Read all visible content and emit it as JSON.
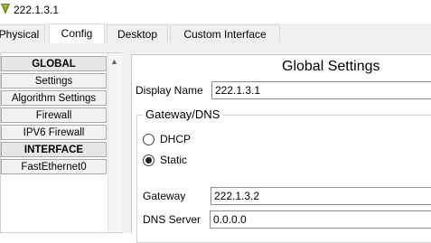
{
  "window": {
    "title": "222.1.3.1",
    "icon": "packet-tracer-app-icon"
  },
  "tabs": [
    {
      "label": "Physical",
      "active": false
    },
    {
      "label": "Config",
      "active": true
    },
    {
      "label": "Desktop",
      "active": false
    },
    {
      "label": "Custom Interface",
      "active": false
    }
  ],
  "sidebar": {
    "items": [
      {
        "label": "GLOBAL",
        "header": true
      },
      {
        "label": "Settings",
        "header": false
      },
      {
        "label": "Algorithm Settings",
        "header": false
      },
      {
        "label": "Firewall",
        "header": false
      },
      {
        "label": "IPV6 Firewall",
        "header": false
      },
      {
        "label": "INTERFACE",
        "header": true
      },
      {
        "label": "FastEthernet0",
        "header": false
      }
    ]
  },
  "main": {
    "title": "Global Settings",
    "display_name": {
      "label": "Display Name",
      "value": "222.1.3.1"
    },
    "gateway_dns": {
      "title": "Gateway/DNS",
      "dhcp_label": "DHCP",
      "static_label": "Static",
      "selected": "Static",
      "gateway": {
        "label": "Gateway",
        "value": "222.1.3.2"
      },
      "dns": {
        "label": "DNS Server",
        "value": "0.0.0.0"
      }
    }
  }
}
